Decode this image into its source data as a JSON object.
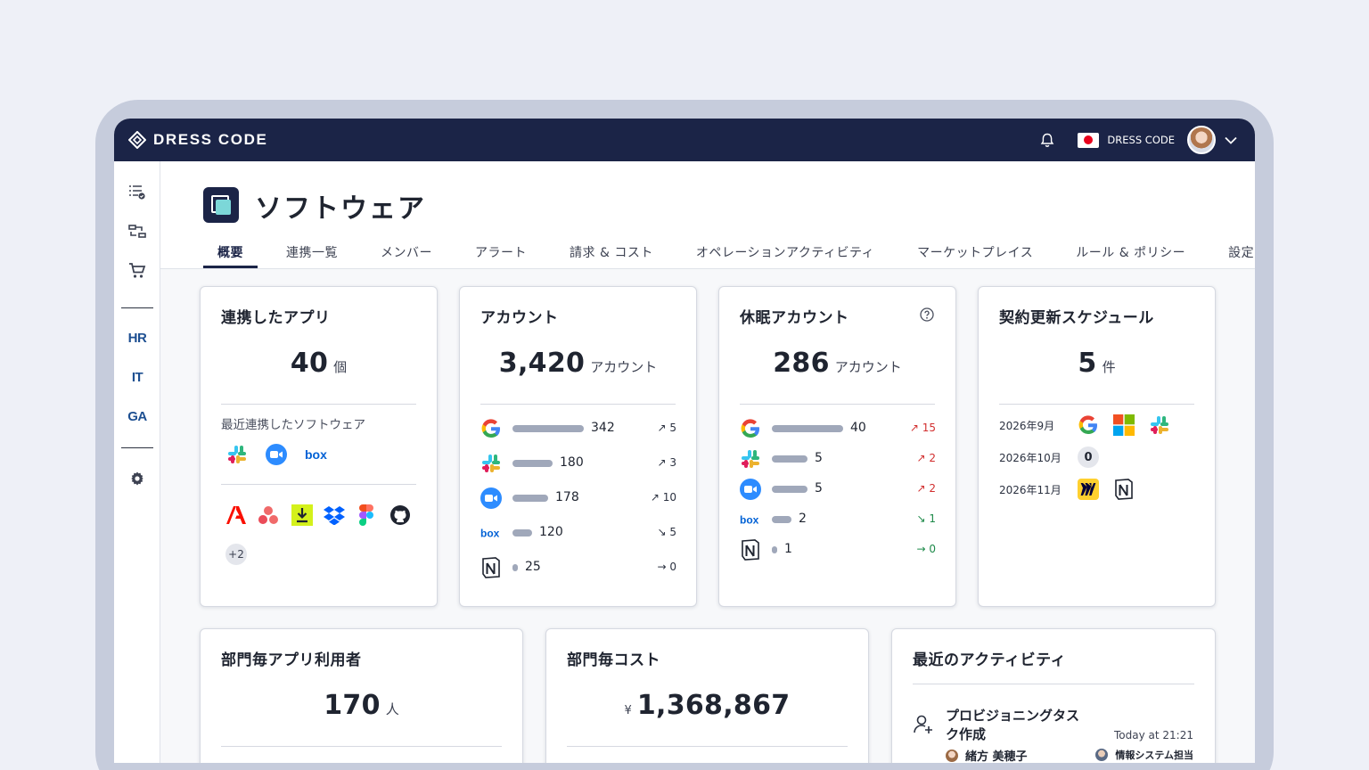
{
  "app": {
    "brand": "DRESS CODE",
    "org_name": "DRESS CODE"
  },
  "page": {
    "title": "ソフトウェア"
  },
  "tabs": [
    {
      "label": "概要",
      "active": true
    },
    {
      "label": "連携一覧"
    },
    {
      "label": "メンバー"
    },
    {
      "label": "アラート"
    },
    {
      "label": "請求 & コスト"
    },
    {
      "label": "オペレーションアクティビティ"
    },
    {
      "label": "マーケットプレイス"
    },
    {
      "label": "ルール & ポリシー"
    },
    {
      "label": "設定"
    }
  ],
  "sidebar": {
    "items": [
      {
        "icon": "task-list-icon"
      },
      {
        "icon": "workflow-icon"
      },
      {
        "icon": "cart-icon"
      },
      {
        "label": "HR"
      },
      {
        "label": "IT"
      },
      {
        "label": "GA"
      },
      {
        "icon": "gear-icon"
      }
    ]
  },
  "cards": {
    "integrated_apps": {
      "title": "連携したアプリ",
      "value": "40",
      "unit": "個",
      "recent_label": "最近連携したソフトウェア",
      "recent_icons": [
        "slack-icon",
        "zoom-icon",
        "box-icon"
      ],
      "other_icons": [
        "adobe-icon",
        "asana-icon",
        "download-app-icon",
        "dropbox-icon",
        "figma-icon",
        "github-icon"
      ],
      "more": "+2"
    },
    "accounts": {
      "title": "アカウント",
      "value": "3,420",
      "unit": "アカウント",
      "rows": [
        {
          "icon": "google-icon",
          "value": "342",
          "trend": "↗ 5",
          "fraction": 1.0
        },
        {
          "icon": "slack-icon",
          "value": "180",
          "trend": "↗ 3",
          "fraction": 0.56
        },
        {
          "icon": "zoom-icon",
          "value": "178",
          "trend": "↗ 10",
          "fraction": 0.5
        },
        {
          "icon": "box-icon",
          "value": "120",
          "trend": "↘ 5",
          "fraction": 0.27
        },
        {
          "icon": "notion-icon",
          "value": "25",
          "trend": "→ 0",
          "fraction": 0.07
        }
      ]
    },
    "dormant": {
      "title": "休眠アカウント",
      "value": "286",
      "unit": "アカウント",
      "rows": [
        {
          "icon": "google-icon",
          "value": "40",
          "trend": "↗ 15",
          "tone": "red",
          "fraction": 1.0
        },
        {
          "icon": "slack-icon",
          "value": "5",
          "trend": "↗ 2",
          "tone": "red",
          "fraction": 0.5
        },
        {
          "icon": "zoom-icon",
          "value": "5",
          "trend": "↗ 2",
          "tone": "red",
          "fraction": 0.5
        },
        {
          "icon": "box-icon",
          "value": "2",
          "trend": "↘ 1",
          "tone": "green",
          "fraction": 0.27
        },
        {
          "icon": "notion-icon",
          "value": "1",
          "trend": "→ 0",
          "tone": "green",
          "fraction": 0.07
        }
      ]
    },
    "renewal": {
      "title": "契約更新スケジュール",
      "value": "5",
      "unit": "件",
      "rows": [
        {
          "month": "2026年9月",
          "icons": [
            "google-icon",
            "microsoft-icon",
            "slack-icon"
          ]
        },
        {
          "month": "2026年10月",
          "count": "0"
        },
        {
          "month": "2026年11月",
          "icons": [
            "miro-icon",
            "notion-icon"
          ]
        }
      ]
    },
    "dept_users": {
      "title": "部門毎アプリ利用者",
      "value": "170",
      "unit": "人"
    },
    "dept_cost": {
      "title": "部門毎コスト",
      "currency": "¥",
      "value": "1,368,867"
    },
    "activity": {
      "title": "最近のアクティビティ",
      "item": {
        "title": "プロビジョニングタスク作成",
        "time": "Today at 21:21",
        "user": "緒方 美穂子",
        "team": "情報システム担当"
      }
    }
  },
  "colors": {
    "nav_bg": "#1b2447",
    "accent_teal": "#7cd7d8",
    "trend_red": "#d22f2f",
    "trend_green": "#1e8a4a",
    "bar": "#a0a8ba"
  }
}
